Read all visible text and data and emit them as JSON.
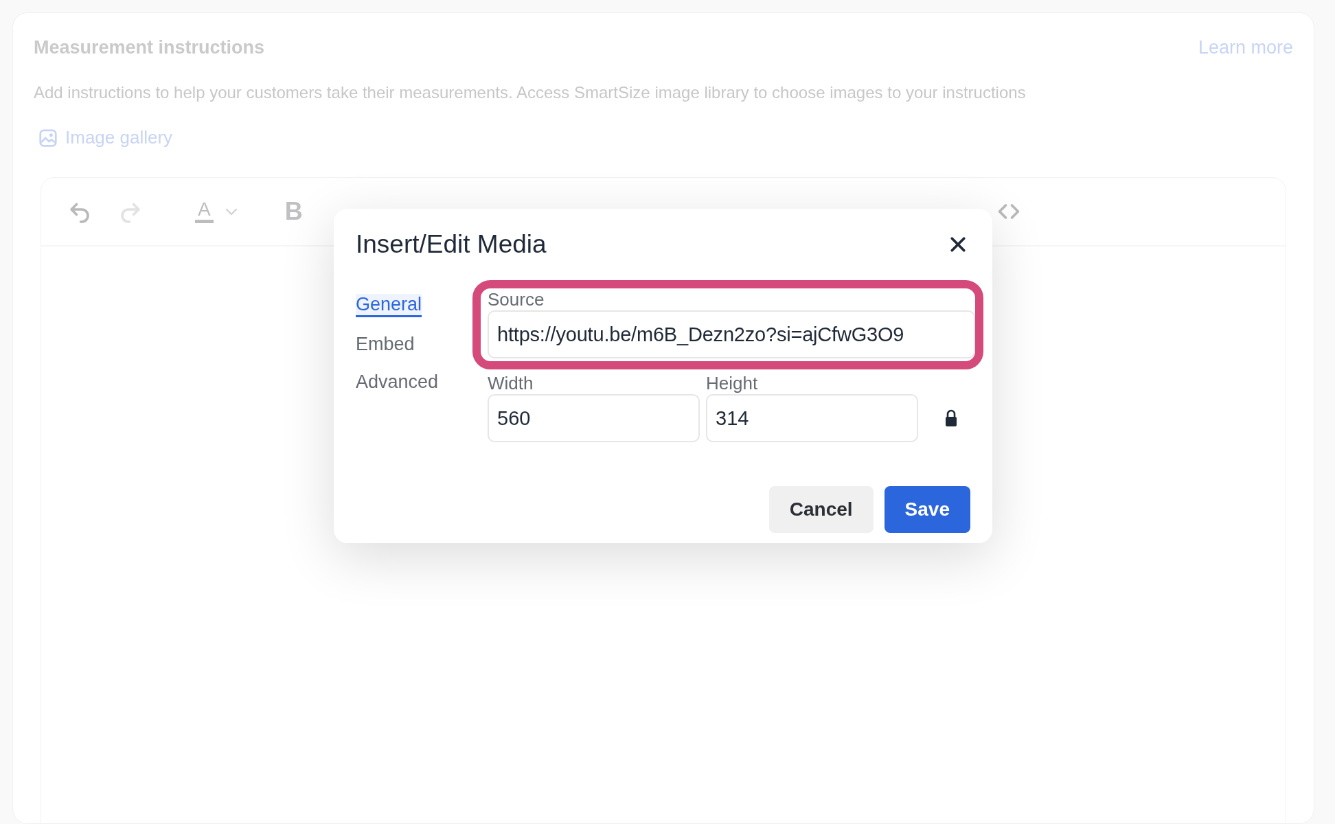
{
  "page": {
    "title": "Measurement instructions",
    "learn_more": "Learn more",
    "description": "Add instructions to help your customers take their measurements. Access SmartSize image library to choose images to your instructions",
    "gallery_link": "Image gallery"
  },
  "toolbar": [
    {
      "kind": "undo",
      "disabled": false
    },
    {
      "kind": "redo",
      "disabled": true
    },
    {
      "kind": "color",
      "label": "A"
    },
    {
      "kind": "bold",
      "label": "B"
    },
    {
      "kind": "code"
    }
  ],
  "dialog": {
    "title": "Insert/Edit Media",
    "tabs": [
      {
        "label": "General",
        "selected": true
      },
      {
        "label": "Embed",
        "selected": false
      },
      {
        "label": "Advanced",
        "selected": false
      }
    ],
    "source": {
      "label": "Source",
      "value": "https://youtu.be/m6B_Dezn2zo?si=ajCfwG3O9",
      "highlighted": true
    },
    "width": {
      "label": "Width",
      "value": "560"
    },
    "height": {
      "label": "Height",
      "value": "314"
    },
    "locked": true,
    "buttons": [
      {
        "kind": "secondary",
        "label": "Cancel"
      },
      {
        "kind": "primary",
        "label": "Save"
      }
    ]
  }
}
